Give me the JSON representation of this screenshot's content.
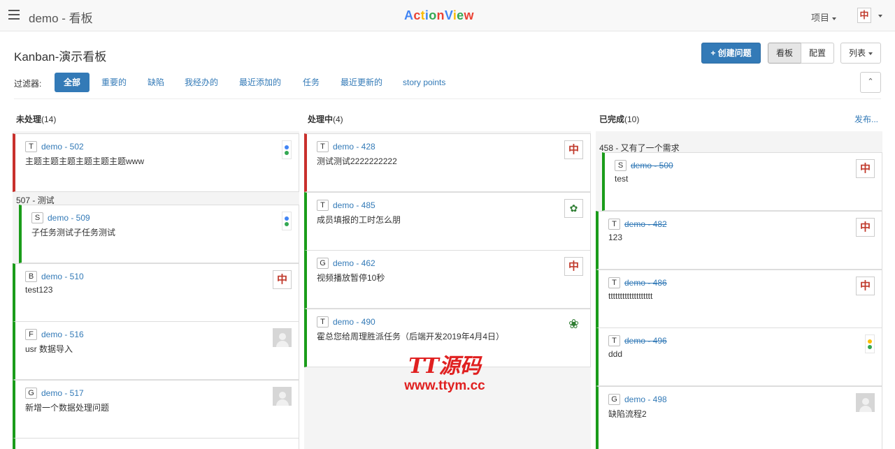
{
  "nav": {
    "project": "demo - 看板",
    "brand_letters": [
      "A",
      "c",
      "t",
      "i",
      "o",
      "n",
      "V",
      "i",
      "e",
      "w"
    ],
    "menu_project": "项目",
    "user_avatar_glyph": "中"
  },
  "header": {
    "title": "Kanban-演示看板",
    "create_label": "创建问题",
    "board_label": "看板",
    "config_label": "配置",
    "list_label": "列表"
  },
  "filters": {
    "label": "过滤器:",
    "items": [
      "全部",
      "重要的",
      "缺陷",
      "我经办的",
      "最近添加的",
      "任务",
      "最近更新的",
      "story points"
    ]
  },
  "columns": [
    {
      "title": "未处理",
      "count": "(14)"
    },
    {
      "title": "处理中",
      "count": "(4)"
    },
    {
      "title": "已完成",
      "count": "(10)",
      "action": "发布..."
    }
  ],
  "parents": {
    "p507": "507 - 测试",
    "p458": "458 - 又有了一个需求"
  },
  "cards": {
    "c502": {
      "type": "T",
      "key": "demo - 502",
      "summary": "主题主题主题主题主题主题www"
    },
    "c509": {
      "type": "S",
      "key": "demo - 509",
      "summary": "子任务测试子任务测试"
    },
    "c510": {
      "type": "B",
      "key": "demo - 510",
      "summary": "test123"
    },
    "c516": {
      "type": "F",
      "key": "demo - 516",
      "summary": "usr 数据导入"
    },
    "c517": {
      "type": "G",
      "key": "demo - 517",
      "summary": "新增一个数据处理问题"
    },
    "c428": {
      "type": "T",
      "key": "demo - 428",
      "summary": "测试测试2222222222"
    },
    "c485": {
      "type": "T",
      "key": "demo - 485",
      "summary": "成员填报的工时怎么朋"
    },
    "c462": {
      "type": "G",
      "key": "demo - 462",
      "summary": "视频播放暂停10秒"
    },
    "c490": {
      "type": "T",
      "key": "demo - 490",
      "summary": "霍总您给周理胜派任务（后端开发2019年4月4日）"
    },
    "c500": {
      "type": "S",
      "key": "demo - 500",
      "summary": "test"
    },
    "c482": {
      "type": "T",
      "key": "demo - 482",
      "summary": "123"
    },
    "c486": {
      "type": "T",
      "key": "demo - 486",
      "summary": "ttttttttttttttttttt"
    },
    "c496": {
      "type": "T",
      "key": "demo - 496",
      "summary": "ddd"
    },
    "c498": {
      "type": "G",
      "key": "demo - 498",
      "summary": "缺陷流程2"
    }
  },
  "avatar_glyph": "中",
  "watermark": {
    "line1": "TT源码",
    "line2": "www.ttym.cc"
  },
  "colors": {
    "primary": "#337ab7",
    "priority_high": "#c9302c",
    "priority_normal": "#1a9c1a"
  }
}
